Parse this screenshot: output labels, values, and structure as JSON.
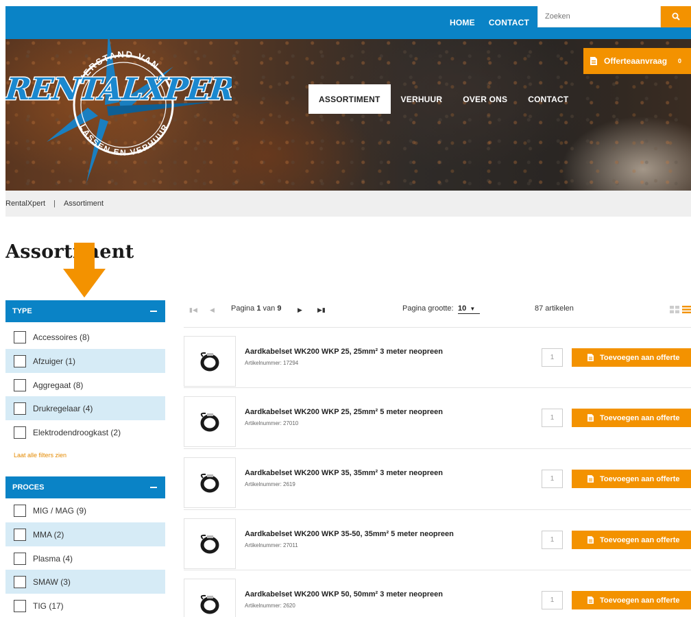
{
  "topbar": {
    "nav": [
      "HOME",
      "CONTACT"
    ],
    "search_placeholder": "Zoeken"
  },
  "logo": {
    "brand_text": "RENTALXPERT",
    "tagline_top": "VERSTAND VAN",
    "tagline_bottom": "LASSEN EN VERHUUR"
  },
  "mainnav": {
    "items": [
      "ASSORTIMENT",
      "VERHUUR",
      "OVER ONS",
      "CONTACT"
    ],
    "active_index": 0,
    "offerte_label": "Offerteaanvraag",
    "offerte_count": "0"
  },
  "breadcrumb": {
    "home": "RentalXpert",
    "separator": "|",
    "current": "Assortiment"
  },
  "page_title": "Assortiment",
  "filters": {
    "type": {
      "title": "TYPE",
      "items": [
        "Accessoires (8)",
        "Afzuiger (1)",
        "Aggregaat (8)",
        "Drukregelaar (4)",
        "Elektrodendroogkast (2)"
      ],
      "show_all": "Laat alle filters zien"
    },
    "proces": {
      "title": "PROCES",
      "items": [
        "MIG / MAG (9)",
        "MMA (2)",
        "Plasma (4)",
        "SMAW (3)",
        "TIG (17)"
      ]
    }
  },
  "toolbar": {
    "page_prefix": "Pagina",
    "page_current": "1",
    "page_of": "van",
    "page_total": "9",
    "page_size_label": "Pagina grootte:",
    "page_size_value": "10",
    "item_count": "87 artikelen"
  },
  "products": [
    {
      "name": "Aardkabelset WK200 WKP 25, 25mm² 3 meter neopreen",
      "number": "Artikelnummer: 17294",
      "qty": "1",
      "button": "Toevoegen aan offerte"
    },
    {
      "name": "Aardkabelset WK200 WKP 25, 25mm² 5 meter neopreen",
      "number": "Artikelnummer: 27010",
      "qty": "1",
      "button": "Toevoegen aan offerte"
    },
    {
      "name": "Aardkabelset WK200 WKP 35, 35mm² 3 meter neopreen",
      "number": "Artikelnummer: 2619",
      "qty": "1",
      "button": "Toevoegen aan offerte"
    },
    {
      "name": "Aardkabelset WK200 WKP 35-50, 35mm² 5 meter neopreen",
      "number": "Artikelnummer: 27011",
      "qty": "1",
      "button": "Toevoegen aan offerte"
    },
    {
      "name": "Aardkabelset WK200 WKP 50, 50mm² 3 meter neopreen",
      "number": "Artikelnummer: 2620",
      "qty": "1",
      "button": "Toevoegen aan offerte"
    }
  ],
  "colors": {
    "brand_blue": "#0a83c6",
    "accent_orange": "#f39200",
    "row_shade": "#d6ebf6"
  }
}
